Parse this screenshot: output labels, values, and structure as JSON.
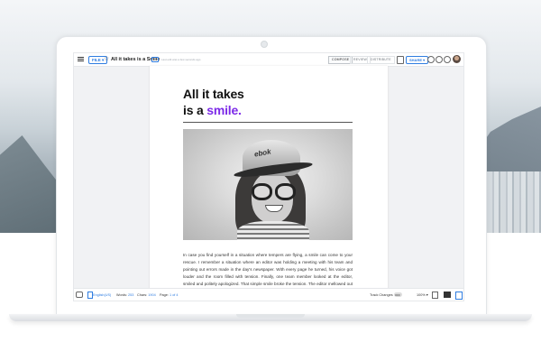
{
  "topbar": {
    "file_label": "FILE ▾",
    "doc_title": "All it takes is a Smile",
    "last_edit": "Last edit was a few seconds ago",
    "tabs": [
      {
        "label": "COMPOSE",
        "active": true
      },
      {
        "label": "REVIEW",
        "active": false
      },
      {
        "label": "DISTRIBUTE",
        "active": false
      }
    ],
    "share_label": "SHARE ▾"
  },
  "document": {
    "heading_line1": "All it takes",
    "heading_line2_prefix": "is a ",
    "heading_line2_accent": "smile.",
    "body": "In case you find yourself in a situation where tempers are flying, a smile can come to your rescue. I remember a situation where an editor was holding a meeting with his team and pointing out errors made in the day's newspaper. With every page he turned, his voice got louder and the room filled with tension. Finally, one team member looked at the editor, smiled and politely apologized. That simple smile broke the tension. The editor mellowed out and moved on to a different subject.",
    "photo_cap_text": "ebok"
  },
  "statusbar": {
    "language": "English(US)",
    "words_label": "Words:",
    "words_value": "253",
    "chars_label": "Chars:",
    "chars_value": "1904",
    "page_label": "Page:",
    "page_value": "1",
    "page_of": "of 4",
    "track_changes": "Track Changes",
    "track_state": "OFF",
    "zoom": "100% ▾"
  },
  "colors": {
    "accent": "#7c2ae8",
    "brand_blue": "#2f7de1"
  },
  "icons": [
    "menu-icon",
    "star-icon",
    "folder-icon",
    "page-settings-icon",
    "user-icon",
    "help-icon",
    "settings-icon",
    "avatar",
    "chat-icon",
    "language-icon",
    "layout-icon",
    "dark-layout-icon",
    "blue-layout-icon"
  ]
}
